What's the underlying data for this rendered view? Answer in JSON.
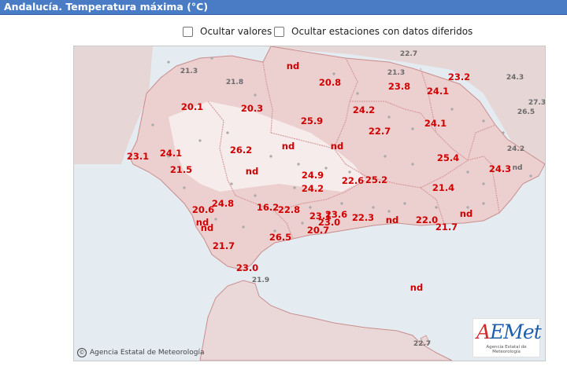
{
  "title": "Andalucía. Temperatura máxima (°C)",
  "options": [
    {
      "label": "Ocultar valores",
      "checked": false
    },
    {
      "label": "Ocultar estaciones con datos diferidos",
      "checked": false
    }
  ],
  "copyright": "Agencia Estatal de Meteorología",
  "logo": {
    "brand_a": "A",
    "brand_rest": "EMet",
    "subtitle": "Agencia Estatal de Meteorología"
  },
  "colors": {
    "value": "#d10000",
    "deferred": "#6a6a6a",
    "sea": "#e4ecf2",
    "land": "#e8d0d0"
  },
  "values": [
    {
      "t": "nd"
    },
    {
      "t": "20.8"
    },
    {
      "t": "23.8"
    },
    {
      "t": "23.2"
    },
    {
      "t": "24.1"
    },
    {
      "t": "20.1"
    },
    {
      "t": "20.3"
    },
    {
      "t": "24.2"
    },
    {
      "t": "25.9"
    },
    {
      "t": "24.1"
    },
    {
      "t": "22.7"
    },
    {
      "t": "nd"
    },
    {
      "t": "nd"
    },
    {
      "t": "26.2"
    },
    {
      "t": "23.1"
    },
    {
      "t": "24.1"
    },
    {
      "t": "25.4"
    },
    {
      "t": "21.5"
    },
    {
      "t": "nd"
    },
    {
      "t": "24.3"
    },
    {
      "t": "24.9"
    },
    {
      "t": "22.6"
    },
    {
      "t": "25.2"
    },
    {
      "t": "24.2"
    },
    {
      "t": "21.4"
    },
    {
      "t": "24.8"
    },
    {
      "t": "16.2"
    },
    {
      "t": "22.8"
    },
    {
      "t": "20.6"
    },
    {
      "t": "23.6"
    },
    {
      "t": "23.1"
    },
    {
      "t": "nd"
    },
    {
      "t": "22.3"
    },
    {
      "t": "nd"
    },
    {
      "t": "22.0"
    },
    {
      "t": "nd"
    },
    {
      "t": "23.0"
    },
    {
      "t": "21.7"
    },
    {
      "t": "20.7"
    },
    {
      "t": "nd"
    },
    {
      "t": "26.5"
    },
    {
      "t": "21.7"
    },
    {
      "t": "23.0"
    },
    {
      "t": "nd"
    }
  ],
  "deferred": [
    {
      "t": "22.7"
    },
    {
      "t": "21.3"
    },
    {
      "t": "21.8"
    },
    {
      "t": "21.3"
    },
    {
      "t": "24.3"
    },
    {
      "t": "27.3"
    },
    {
      "t": "26.5"
    },
    {
      "t": "24.2"
    },
    {
      "t": "nd"
    },
    {
      "t": "21.9"
    },
    {
      "t": "22.7"
    }
  ]
}
